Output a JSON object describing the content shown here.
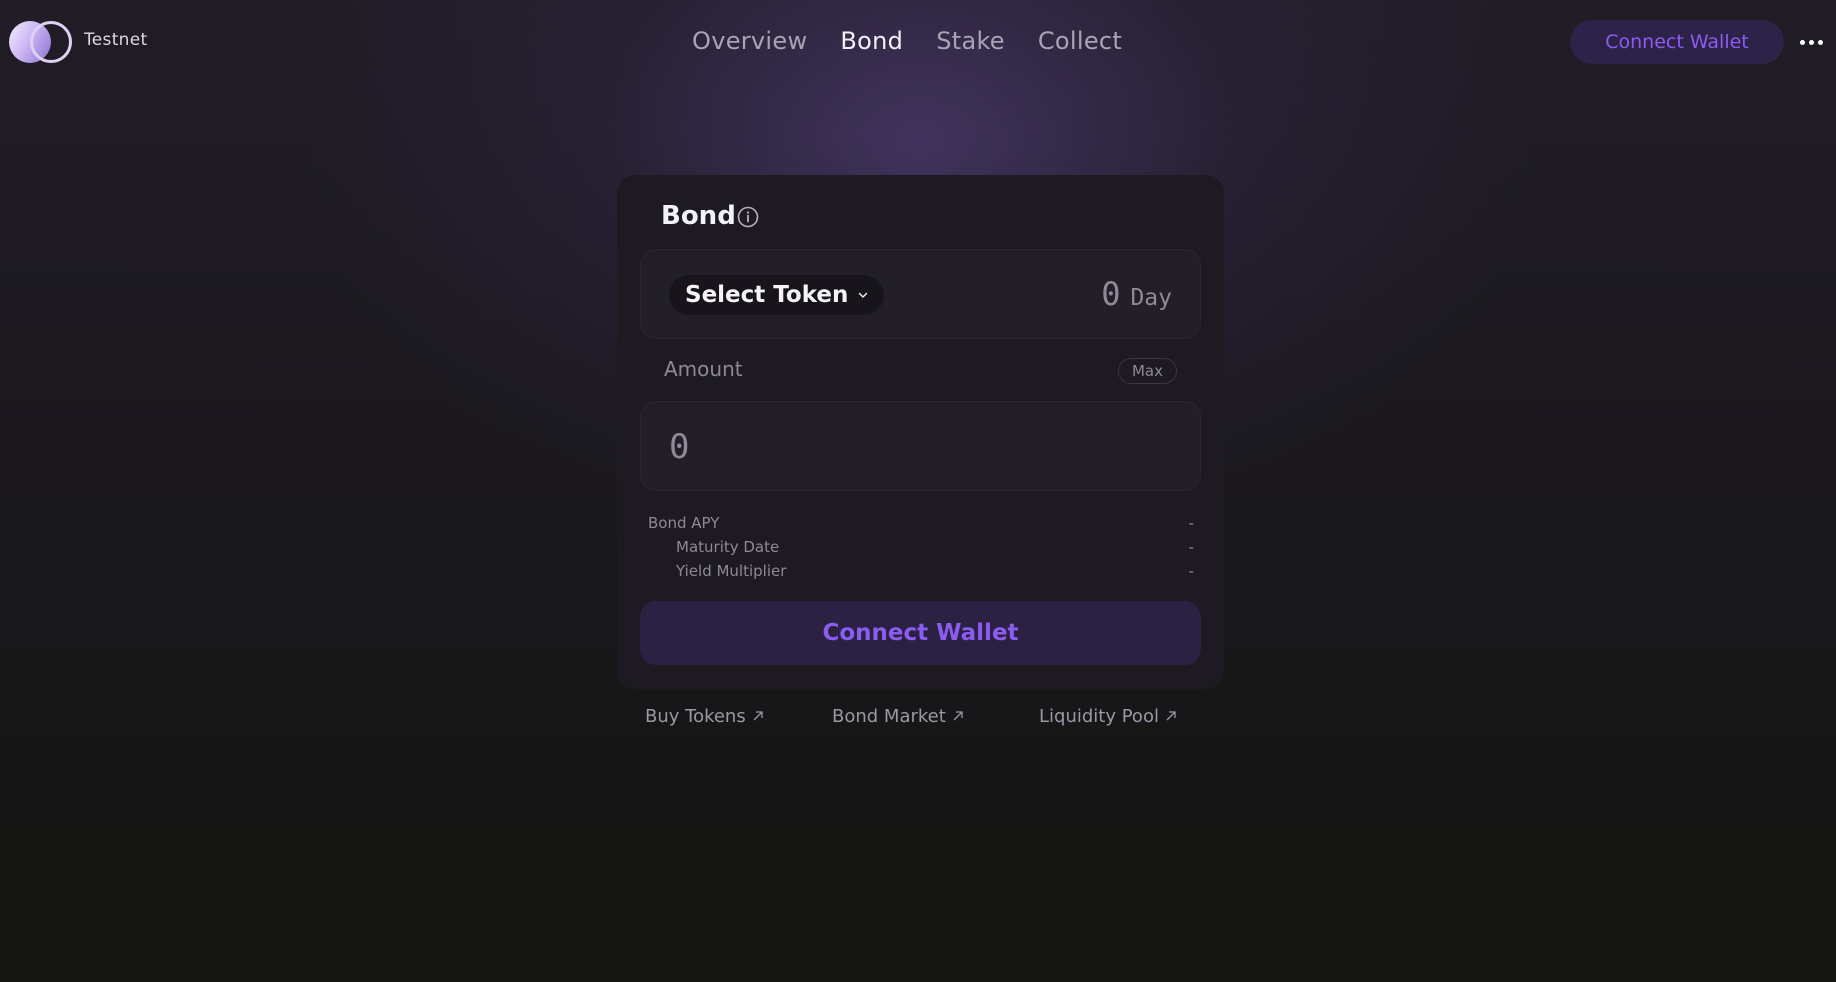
{
  "header": {
    "brand": "Testnet",
    "nav": [
      "Overview",
      "Bond",
      "Stake",
      "Collect"
    ],
    "active_nav": "Bond",
    "connect_label": "Connect Wallet",
    "more_icon": "ellipsis-icon"
  },
  "card": {
    "title": "Bond",
    "info_icon": "info-icon",
    "select_token_label": "Select Token",
    "days_value": "0",
    "days_unit": "Day",
    "amount_label": "Amount",
    "max_label": "Max",
    "amount_placeholder": "0",
    "stats": [
      {
        "label": "Bond APY",
        "value": "-"
      },
      {
        "label": "Maturity Date",
        "value": "-"
      },
      {
        "label": "Yield Multiplier",
        "value": "-"
      }
    ],
    "connect_label": "Connect Wallet"
  },
  "links": [
    "Buy Tokens",
    "Bond Market",
    "Liquidity Pool"
  ],
  "colors": {
    "accent": "#8c5cf0",
    "button_bg": "#2b2142",
    "card_bg": "#1d1a22"
  }
}
